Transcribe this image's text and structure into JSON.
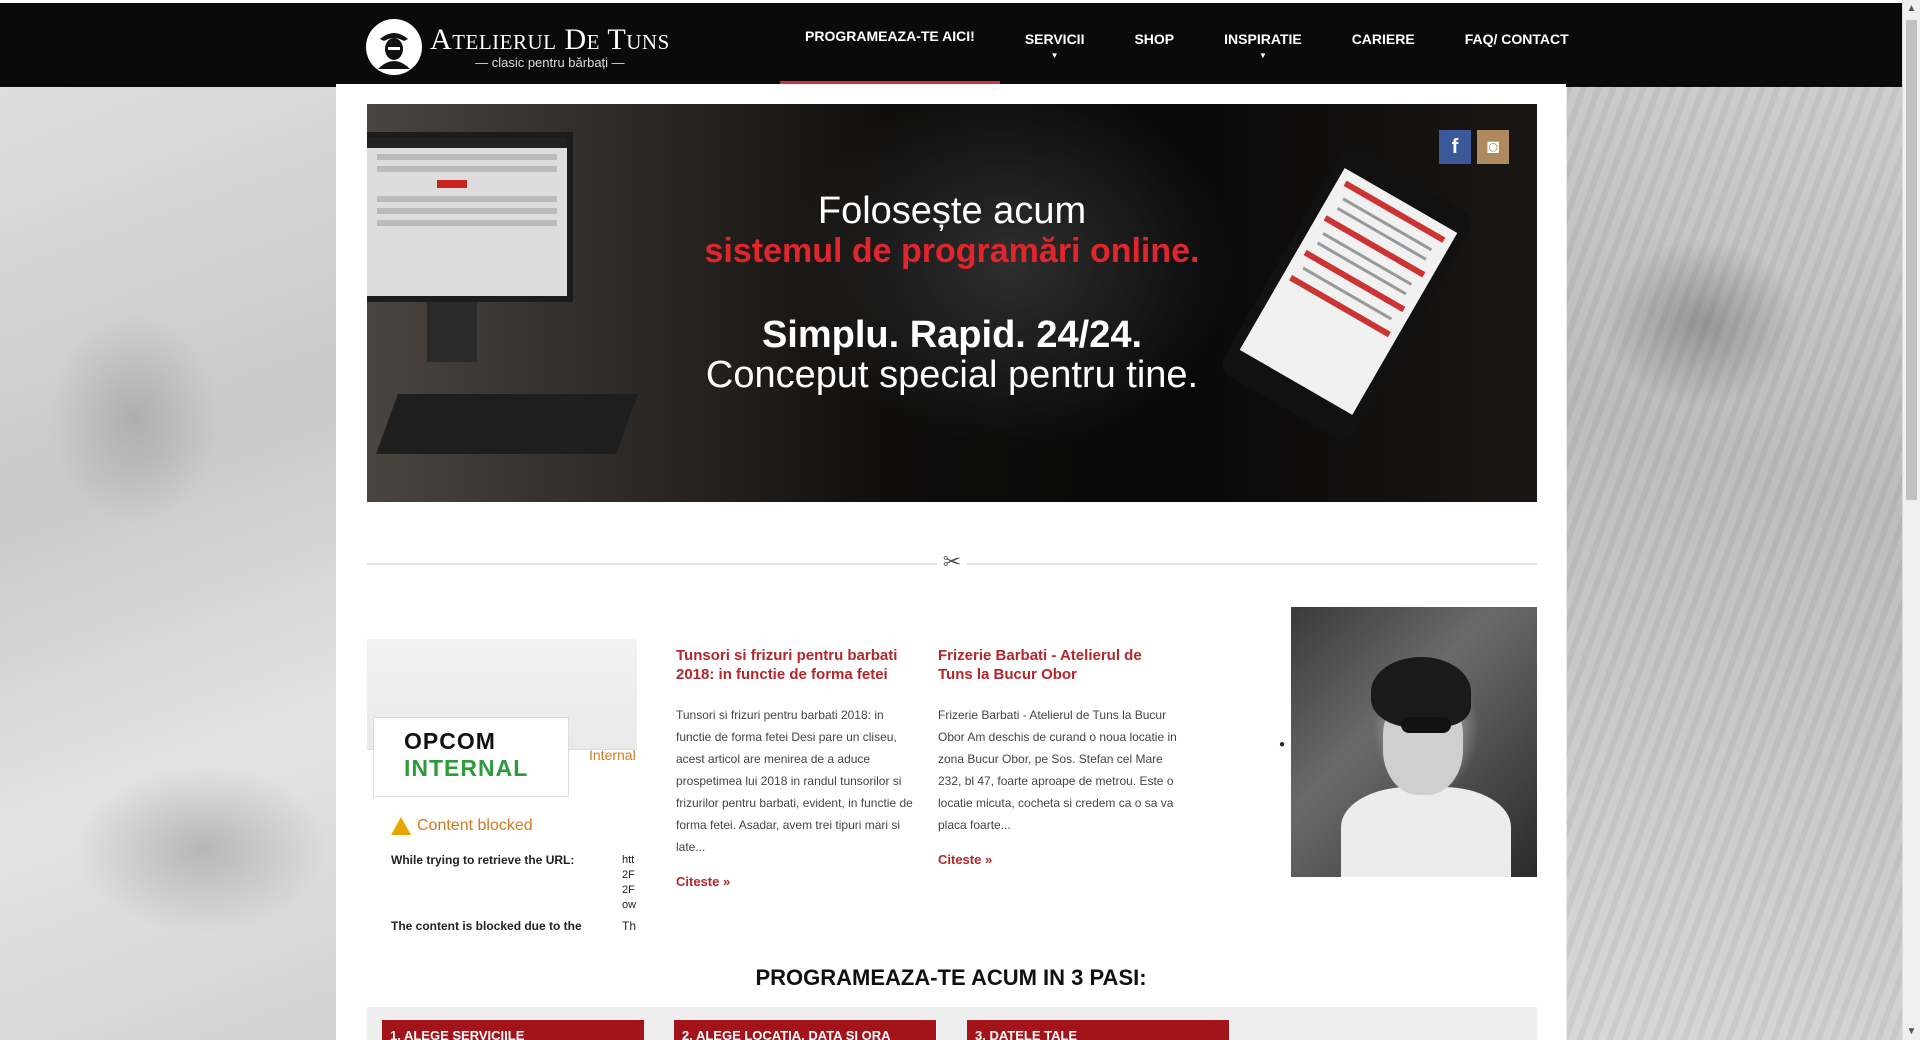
{
  "header": {
    "logo": {
      "title": "Atelierul De Tuns",
      "subtitle": "clasic pentru bărbați"
    },
    "nav": [
      {
        "label": "PROGRAMEAZA-TE AICI!",
        "active": true,
        "dropdown": false
      },
      {
        "label": "SERVICII",
        "active": false,
        "dropdown": true
      },
      {
        "label": "SHOP",
        "active": false,
        "dropdown": false
      },
      {
        "label": "INSPIRATIE",
        "active": false,
        "dropdown": true
      },
      {
        "label": "CARIERE",
        "active": false,
        "dropdown": false
      },
      {
        "label": "FAQ/ CONTACT",
        "active": false,
        "dropdown": false
      }
    ]
  },
  "banner": {
    "line1": "Folosește acum",
    "line2": "sistemul de programări online.",
    "line3": "Simplu. Rapid. 24/24.",
    "line4": "Conceput special pentru tine.",
    "social": [
      {
        "icon": "facebook-icon",
        "glyph": "f"
      },
      {
        "icon": "instagram-icon",
        "glyph": "◙"
      }
    ]
  },
  "blocked": {
    "opcom_line1": "OPCOM",
    "opcom_line2": "INTERNAL",
    "internal": "Internal",
    "title": "Content blocked",
    "line1": "While trying to retrieve the URL:",
    "url_fragment": "htt 2F 2F ow",
    "line2": "The content is blocked due to the",
    "line2_tail": "Th"
  },
  "posts": [
    {
      "title": "Tunsori si frizuri pentru barbati 2018: in functie de forma fetei",
      "excerpt": "Tunsori si frizuri pentru barbati 2018: in functie de forma fetei Desi pare un cliseu, acest articol are menirea de a aduce prospetimea lui 2018 in randul tunsorilor si frizurilor pentru barbati, evident, in functie de forma fetei. Asadar, avem trei tipuri mari si late...",
      "more": "Citeste »"
    },
    {
      "title": "Frizerie Barbati - Atelierul de Tuns la Bucur Obor",
      "excerpt": "Frizerie Barbati - Atelierul de Tuns la Bucur Obor Am deschis de curand o noua locatie in zona Bucur Obor, pe Sos. Stefan cel Mare 232, bl 47, foarte aproape de metrou. Este o locatie micuta, cocheta si credem ca o sa va placa foarte...",
      "more": "Citeste »"
    }
  ],
  "steps": {
    "title": "PROGRAMEAZA-TE ACUM IN 3 PASI:",
    "items": [
      "1. ALEGE SERVICIILE",
      "2. ALEGE LOCATIA, DATA SI ORA",
      "3. DATELE TALE"
    ]
  },
  "colors": {
    "accent": "#b3262c",
    "header_bg": "#0a0a0a",
    "banner_red": "#e0262c"
  }
}
